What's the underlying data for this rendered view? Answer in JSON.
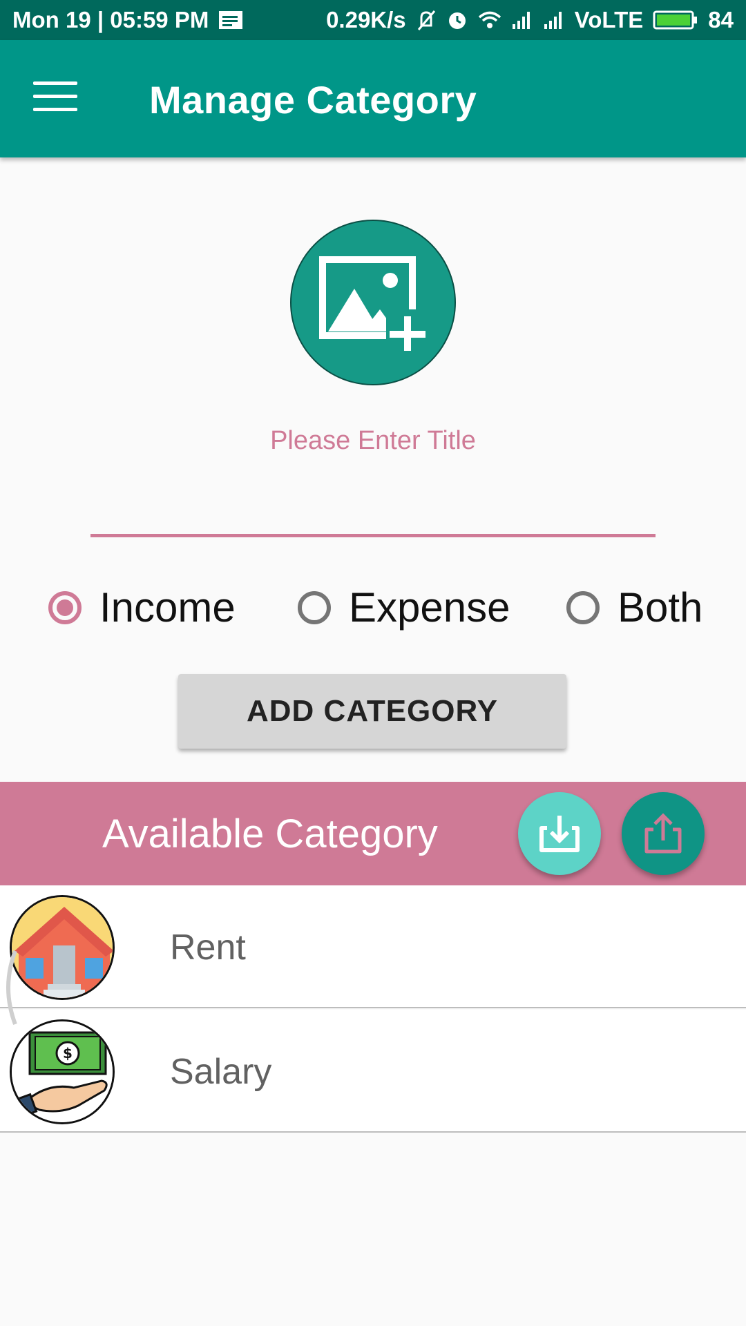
{
  "status_bar": {
    "datetime": "Mon 19 | 05:59 PM",
    "speed": "0.29K/s",
    "network": "VoLTE",
    "battery": "84"
  },
  "app_bar": {
    "title": "Manage Category",
    "menu_icon": "hamburger-menu-icon"
  },
  "form": {
    "image_picker_icon": "add-photo-icon",
    "title_label": "Please Enter Title",
    "title_value": "",
    "type_options": [
      {
        "label": "Income",
        "checked": true
      },
      {
        "label": "Expense",
        "checked": false
      },
      {
        "label": "Both",
        "checked": false
      }
    ],
    "add_button_label": "ADD CATEGORY"
  },
  "categories_section": {
    "title": "Available Category",
    "import_icon": "import-icon",
    "export_icon": "export-icon",
    "items": [
      {
        "label": "Rent",
        "icon": "house-icon"
      },
      {
        "label": "Salary",
        "icon": "money-hand-icon"
      }
    ]
  },
  "colors": {
    "primary": "#009688",
    "primary_dark": "#00695c",
    "accent": "#cf7a96",
    "fab_light": "#5dd3c7"
  }
}
